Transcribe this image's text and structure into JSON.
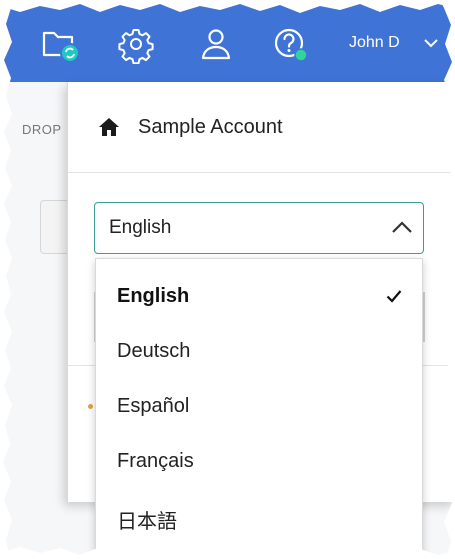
{
  "header": {
    "user_name": "John D",
    "icons": [
      "folder-sync-icon",
      "gear-icon",
      "user-icon",
      "help-icon"
    ],
    "brand_color": "#3f74d6",
    "status_dot_color": "#2fd49b"
  },
  "background": {
    "crop_text": "DROP"
  },
  "account_menu": {
    "account_name": "Sample Account",
    "language_select": {
      "value": "English",
      "border_color": "#3d9e93"
    },
    "languages": [
      {
        "label": "English",
        "selected": true
      },
      {
        "label": "Deutsch",
        "selected": false
      },
      {
        "label": "Español",
        "selected": false
      },
      {
        "label": "Français",
        "selected": false
      },
      {
        "label": "日本語",
        "selected": false
      }
    ]
  }
}
